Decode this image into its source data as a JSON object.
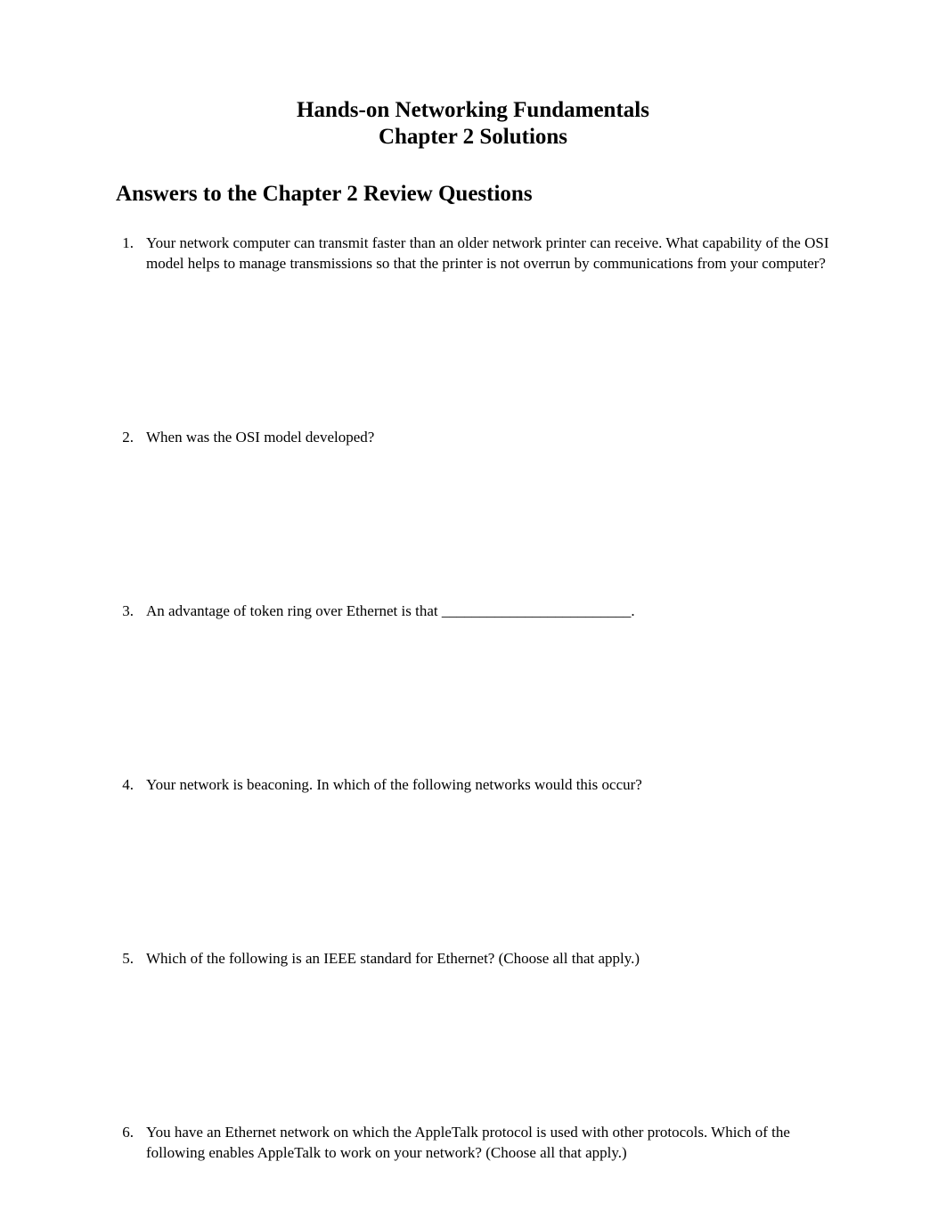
{
  "header": {
    "title_line1": "Hands-on Networking Fundamentals",
    "title_line2": "Chapter 2 Solutions"
  },
  "subtitle": "Answers to the Chapter 2 Review Questions",
  "questions": [
    {
      "number": "1.",
      "text": "Your network computer can transmit faster than an older network printer can receive. What capability of the OSI model helps to manage transmissions so that the printer is not overrun by communications from your computer?"
    },
    {
      "number": "2.",
      "text": "When was the OSI model developed?"
    },
    {
      "number": "3.",
      "text": "An advantage of token ring over Ethernet is that _________________________."
    },
    {
      "number": "4.",
      "text": "Your network is beaconing. In which of the following networks would this occur?"
    },
    {
      "number": "5.",
      "text": "Which of the following is an IEEE standard for Ethernet? (Choose all that apply.)"
    },
    {
      "number": "6.",
      "text": "You have an Ethernet network on which the AppleTalk protocol is used with other protocols. Which of the following enables AppleTalk to work on your network? (Choose all that apply.)"
    }
  ]
}
